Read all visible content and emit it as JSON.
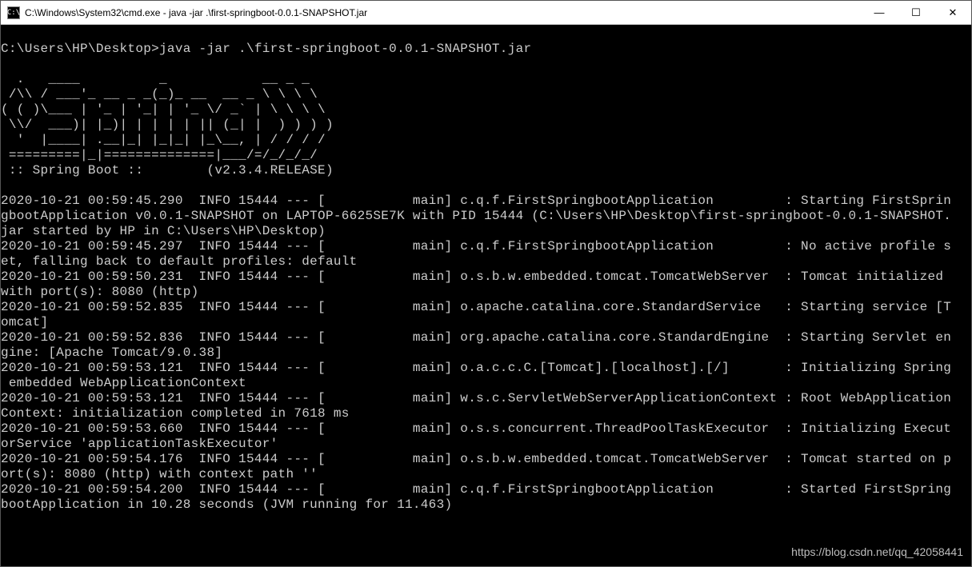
{
  "window": {
    "icon_text": "C:\\",
    "title": "C:\\Windows\\System32\\cmd.exe - java  -jar .\\first-springboot-0.0.1-SNAPSHOT.jar",
    "controls": {
      "minimize": "—",
      "maximize": "☐",
      "close": "✕"
    }
  },
  "terminal": {
    "prompt_line": "C:\\Users\\HP\\Desktop>java -jar .\\first-springboot-0.0.1-SNAPSHOT.jar",
    "banner": "  .   ____          _            __ _ _\n /\\\\ / ___'_ __ _ _(_)_ __  __ _ \\ \\ \\ \\\n( ( )\\___ | '_ | '_| | '_ \\/ _` | \\ \\ \\ \\\n \\\\/  ___)| |_)| | | | | || (_| |  ) ) ) )\n  '  |____| .__|_| |_|_| |_\\__, | / / / /\n =========|_|==============|___/=/_/_/_/\n :: Spring Boot ::        (v2.3.4.RELEASE)",
    "logs": "2020-10-21 00:59:45.290  INFO 15444 --- [           main] c.q.f.FirstSpringbootApplication         : Starting FirstSprin\ngbootApplication v0.0.1-SNAPSHOT on LAPTOP-6625SE7K with PID 15444 (C:\\Users\\HP\\Desktop\\first-springboot-0.0.1-SNAPSHOT.\njar started by HP in C:\\Users\\HP\\Desktop)\n2020-10-21 00:59:45.297  INFO 15444 --- [           main] c.q.f.FirstSpringbootApplication         : No active profile s\net, falling back to default profiles: default\n2020-10-21 00:59:50.231  INFO 15444 --- [           main] o.s.b.w.embedded.tomcat.TomcatWebServer  : Tomcat initialized \nwith port(s): 8080 (http)\n2020-10-21 00:59:52.835  INFO 15444 --- [           main] o.apache.catalina.core.StandardService   : Starting service [T\nomcat]\n2020-10-21 00:59:52.836  INFO 15444 --- [           main] org.apache.catalina.core.StandardEngine  : Starting Servlet en\ngine: [Apache Tomcat/9.0.38]\n2020-10-21 00:59:53.121  INFO 15444 --- [           main] o.a.c.c.C.[Tomcat].[localhost].[/]       : Initializing Spring\n embedded WebApplicationContext\n2020-10-21 00:59:53.121  INFO 15444 --- [           main] w.s.c.ServletWebServerApplicationContext : Root WebApplication\nContext: initialization completed in 7618 ms\n2020-10-21 00:59:53.660  INFO 15444 --- [           main] o.s.s.concurrent.ThreadPoolTaskExecutor  : Initializing Execut\norService 'applicationTaskExecutor'\n2020-10-21 00:59:54.176  INFO 15444 --- [           main] o.s.b.w.embedded.tomcat.TomcatWebServer  : Tomcat started on p\nort(s): 8080 (http) with context path ''\n2020-10-21 00:59:54.200  INFO 15444 --- [           main] c.q.f.FirstSpringbootApplication         : Started FirstSpring\nbootApplication in 10.28 seconds (JVM running for 11.463)"
  },
  "watermark": "https://blog.csdn.net/qq_42058441"
}
